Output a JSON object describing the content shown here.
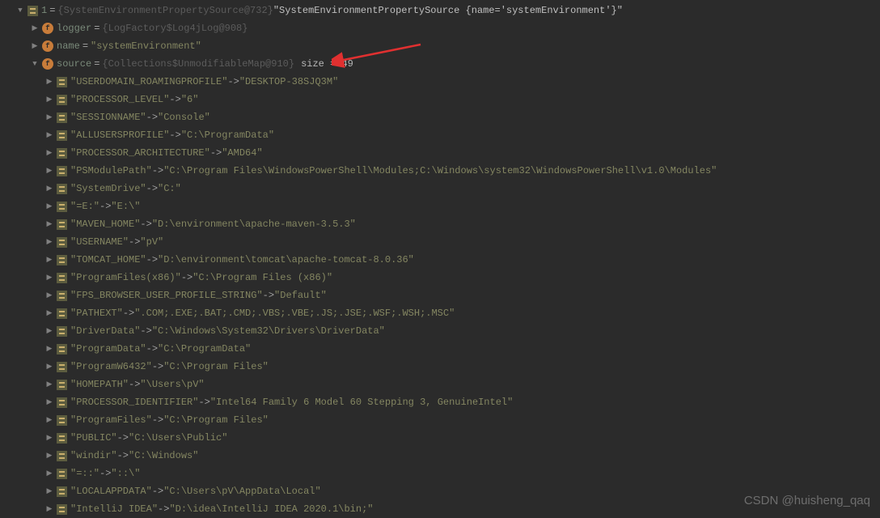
{
  "root": {
    "idx": "1",
    "ref": "{SystemEnvironmentPropertySource@732}",
    "value": "\"SystemEnvironmentPropertySource {name='systemEnvironment'}\""
  },
  "fields": {
    "logger": {
      "name": "logger",
      "ref": "{LogFactory$Log4jLog@908}"
    },
    "name": {
      "name": "name",
      "value": "\"systemEnvironment\""
    },
    "source": {
      "name": "source",
      "ref": "{Collections$UnmodifiableMap@910}",
      "size": "size = 49"
    }
  },
  "entries": [
    {
      "key": "\"USERDOMAIN_ROAMINGPROFILE\"",
      "arrow": " -> ",
      "value": "\"DESKTOP-38SJQ3M\""
    },
    {
      "key": "\"PROCESSOR_LEVEL\"",
      "arrow": " -> ",
      "value": "\"6\""
    },
    {
      "key": "\"SESSIONNAME\"",
      "arrow": " -> ",
      "value": "\"Console\""
    },
    {
      "key": "\"ALLUSERSPROFILE\"",
      "arrow": " -> ",
      "value": "\"C:\\ProgramData\""
    },
    {
      "key": "\"PROCESSOR_ARCHITECTURE\"",
      "arrow": " -> ",
      "value": "\"AMD64\""
    },
    {
      "key": "\"PSModulePath\"",
      "arrow": " -> ",
      "value": "\"C:\\Program Files\\WindowsPowerShell\\Modules;C:\\Windows\\system32\\WindowsPowerShell\\v1.0\\Modules\""
    },
    {
      "key": "\"SystemDrive\"",
      "arrow": " -> ",
      "value": "\"C:\""
    },
    {
      "key": "\"=E:\"",
      "arrow": " -> ",
      "value": "\"E:\\\""
    },
    {
      "key": "\"MAVEN_HOME\"",
      "arrow": " -> ",
      "value": "\"D:\\environment\\apache-maven-3.5.3\""
    },
    {
      "key": "\"USERNAME\"",
      "arrow": " -> ",
      "value": "\"pV\""
    },
    {
      "key": "\"TOMCAT_HOME\"",
      "arrow": " -> ",
      "value": "\"D:\\environment\\tomcat\\apache-tomcat-8.0.36\""
    },
    {
      "key": "\"ProgramFiles(x86)\"",
      "arrow": " -> ",
      "value": "\"C:\\Program Files (x86)\""
    },
    {
      "key": "\"FPS_BROWSER_USER_PROFILE_STRING\"",
      "arrow": " -> ",
      "value": "\"Default\""
    },
    {
      "key": "\"PATHEXT\"",
      "arrow": " -> ",
      "value": "\".COM;.EXE;.BAT;.CMD;.VBS;.VBE;.JS;.JSE;.WSF;.WSH;.MSC\""
    },
    {
      "key": "\"DriverData\"",
      "arrow": " -> ",
      "value": "\"C:\\Windows\\System32\\Drivers\\DriverData\""
    },
    {
      "key": "\"ProgramData\"",
      "arrow": " -> ",
      "value": "\"C:\\ProgramData\""
    },
    {
      "key": "\"ProgramW6432\"",
      "arrow": " -> ",
      "value": "\"C:\\Program Files\""
    },
    {
      "key": "\"HOMEPATH\"",
      "arrow": " -> ",
      "value": "\"\\Users\\pV\""
    },
    {
      "key": "\"PROCESSOR_IDENTIFIER\"",
      "arrow": " -> ",
      "value": "\"Intel64 Family 6 Model 60 Stepping 3, GenuineIntel\""
    },
    {
      "key": "\"ProgramFiles\"",
      "arrow": " -> ",
      "value": "\"C:\\Program Files\""
    },
    {
      "key": "\"PUBLIC\"",
      "arrow": " -> ",
      "value": "\"C:\\Users\\Public\""
    },
    {
      "key": "\"windir\"",
      "arrow": " -> ",
      "value": "\"C:\\Windows\""
    },
    {
      "key": "\"=::\"",
      "arrow": " -> ",
      "value": "\"::\\\""
    },
    {
      "key": "\"LOCALAPPDATA\"",
      "arrow": " -> ",
      "value": "\"C:\\Users\\pV\\AppData\\Local\""
    },
    {
      "key": "\"IntelliJ IDEA\"",
      "arrow": " -> ",
      "value": "\"D:\\idea\\IntelliJ IDEA 2020.1\\bin;\""
    }
  ],
  "watermark": "CSDN @huisheng_qaq"
}
